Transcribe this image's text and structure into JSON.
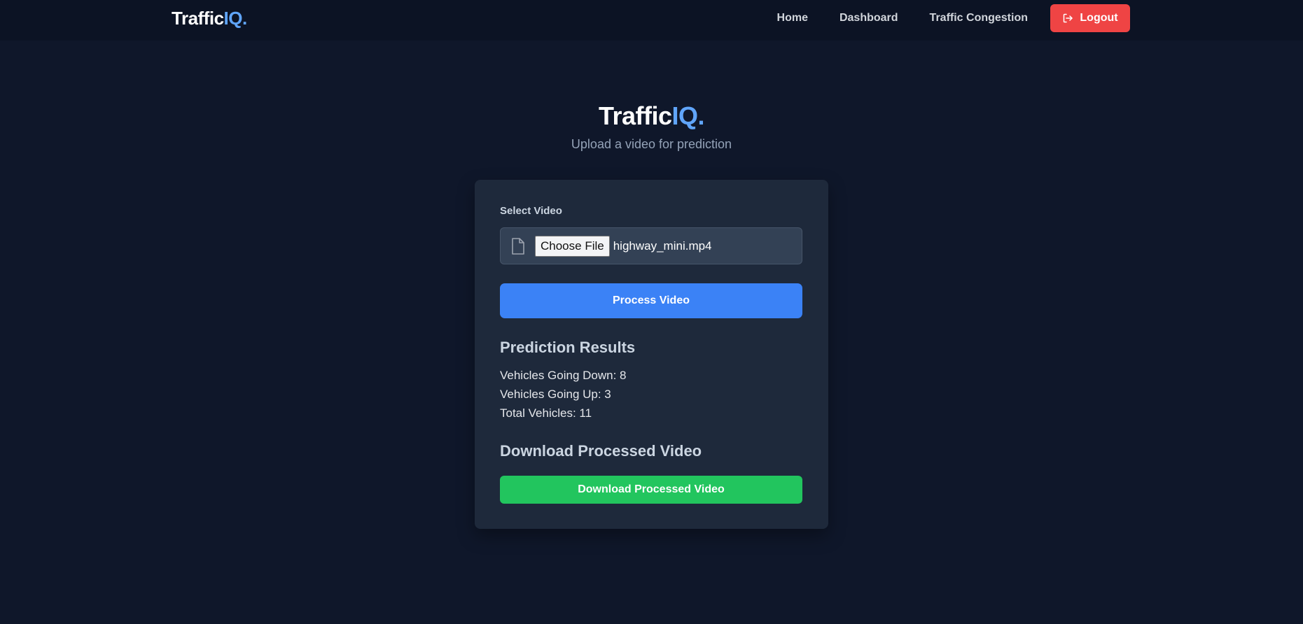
{
  "brand": {
    "name": "Traffic",
    "accent": "IQ."
  },
  "nav": {
    "links": [
      "Home",
      "Dashboard",
      "Traffic Congestion"
    ],
    "logout_label": "Logout"
  },
  "hero": {
    "title": "Traffic",
    "title_accent": "IQ.",
    "subtitle": "Upload a video for prediction"
  },
  "upload": {
    "label": "Select Video",
    "choose_label": "Choose File",
    "file_name": "highway_mini.mp4",
    "process_label": "Process Video"
  },
  "results": {
    "heading": "Prediction Results",
    "lines": [
      "Vehicles Going Down: 8",
      "Vehicles Going Up: 3",
      "Total Vehicles: 11"
    ]
  },
  "download": {
    "heading": "Download Processed Video",
    "button_label": "Download Processed Video"
  },
  "colors": {
    "background": "#0f172a",
    "card": "#1e293b",
    "accent": "#60a5fa",
    "primary_button": "#3b82f6",
    "logout_button": "#ef4444",
    "download_button": "#22c55e"
  },
  "icons": {
    "logout": "logout-arrow-icon",
    "file": "file-icon"
  }
}
